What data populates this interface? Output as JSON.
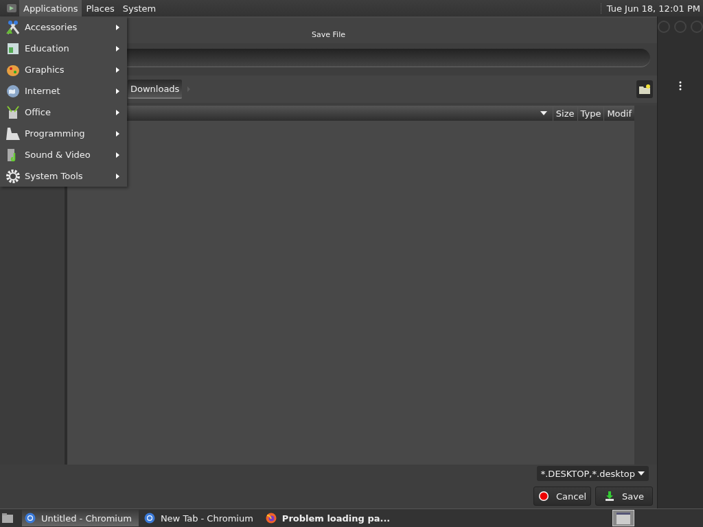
{
  "top_panel": {
    "menus": [
      {
        "label": "Applications",
        "selected": true
      },
      {
        "label": "Places",
        "selected": false
      },
      {
        "label": "System",
        "selected": false
      }
    ],
    "clock": "Tue Jun 18, 12:01 PM"
  },
  "applications_menu": {
    "items": [
      {
        "label": "Accessories",
        "kind": "accessories"
      },
      {
        "label": "Education",
        "kind": "education"
      },
      {
        "label": "Graphics",
        "kind": "graphics"
      },
      {
        "label": "Internet",
        "kind": "internet"
      },
      {
        "label": "Office",
        "kind": "office"
      },
      {
        "label": "Programming",
        "kind": "programming"
      },
      {
        "label": "Sound & Video",
        "kind": "sound"
      },
      {
        "label": "System Tools",
        "kind": "tools"
      }
    ]
  },
  "dialog": {
    "title": "Save File",
    "path": [
      {
        "label": "Downloads",
        "selected": true
      }
    ],
    "columns": [
      "Size",
      "Type",
      "Modif"
    ],
    "filter": "*.DESKTOP,*.desktop",
    "buttons": [
      {
        "label": "Cancel",
        "kind": "cancel"
      },
      {
        "label": "Save",
        "kind": "save"
      }
    ]
  },
  "taskbar": {
    "tasks": [
      {
        "label": "Untitled - Chromium",
        "kind": "chromium",
        "selected": true,
        "urgent": false
      },
      {
        "label": "New Tab - Chromium",
        "kind": "chromium",
        "selected": false,
        "urgent": false
      },
      {
        "label": "Problem loading pa...",
        "kind": "firefox",
        "selected": false,
        "urgent": true
      }
    ]
  }
}
